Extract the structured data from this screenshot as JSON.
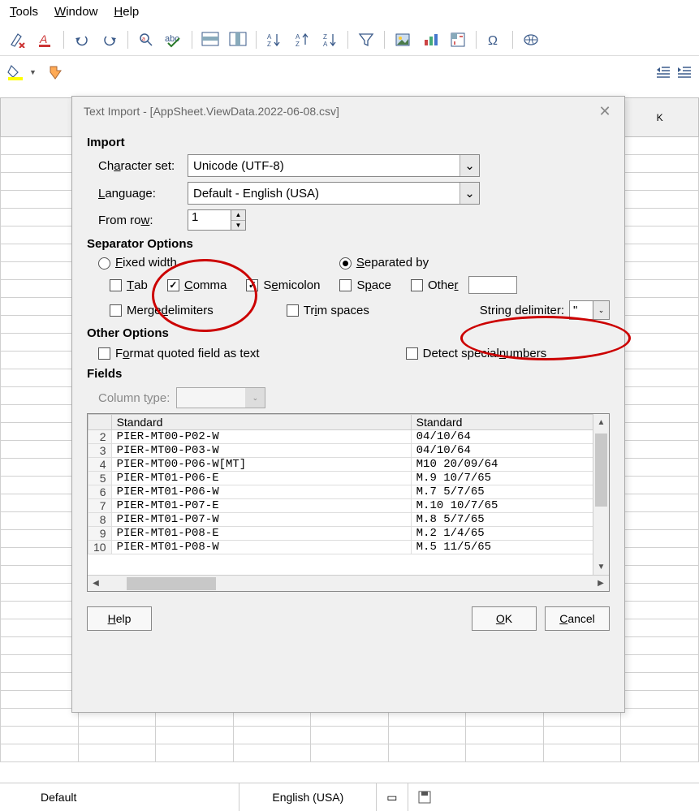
{
  "menu": {
    "tools": "Tools",
    "window": "Window",
    "help": "Help"
  },
  "dialog": {
    "title": "Text Import - [AppSheet.ViewData.2022-06-08.csv]",
    "import_h": "Import",
    "charset_label": "Character set:",
    "charset_value": "Unicode (UTF-8)",
    "language_label": "Language:",
    "language_value": "Default - English (USA)",
    "fromrow_label": "From row:",
    "fromrow_value": "1",
    "sep_h": "Separator Options",
    "fixed": "Fixed width",
    "separated": "Separated by",
    "tab": "Tab",
    "comma": "Comma",
    "semicolon": "Semicolon",
    "space": "Space",
    "other": "Other",
    "merge": "Merge delimiters",
    "trim": "Trim spaces",
    "string_delim_label": "String delimiter:",
    "string_delim_value": "\"",
    "other_h": "Other Options",
    "format_quoted": "Format quoted field as text",
    "detect_special": "Detect special numbers",
    "fields_h": "Fields",
    "coltype_label": "Column type:",
    "col1": "Standard",
    "col2": "Standard",
    "rows": [
      {
        "n": "2",
        "a": "PIER-MT00-P02-W",
        "b": "04/10/64"
      },
      {
        "n": "3",
        "a": "PIER-MT00-P03-W",
        "b": "04/10/64"
      },
      {
        "n": "4",
        "a": "PIER-MT00-P06-W[MT]",
        "b": "M10 20/09/64"
      },
      {
        "n": "5",
        "a": "PIER-MT01-P06-E",
        "b": "M.9 10/7/65"
      },
      {
        "n": "6",
        "a": "PIER-MT01-P06-W",
        "b": "M.7 5/7/65"
      },
      {
        "n": "7",
        "a": "PIER-MT01-P07-E",
        "b": "M.10 10/7/65"
      },
      {
        "n": "8",
        "a": "PIER-MT01-P07-W",
        "b": "M.8 5/7/65"
      },
      {
        "n": "9",
        "a": "PIER-MT01-P08-E",
        "b": "M.2 1/4/65"
      },
      {
        "n": "10",
        "a": "PIER-MT01-P08-W",
        "b": "M.5 11/5/65"
      }
    ],
    "help": "Help",
    "ok": "OK",
    "cancel": "Cancel"
  },
  "status": {
    "style": "Default",
    "lang": "English (USA)"
  },
  "colK": "K"
}
